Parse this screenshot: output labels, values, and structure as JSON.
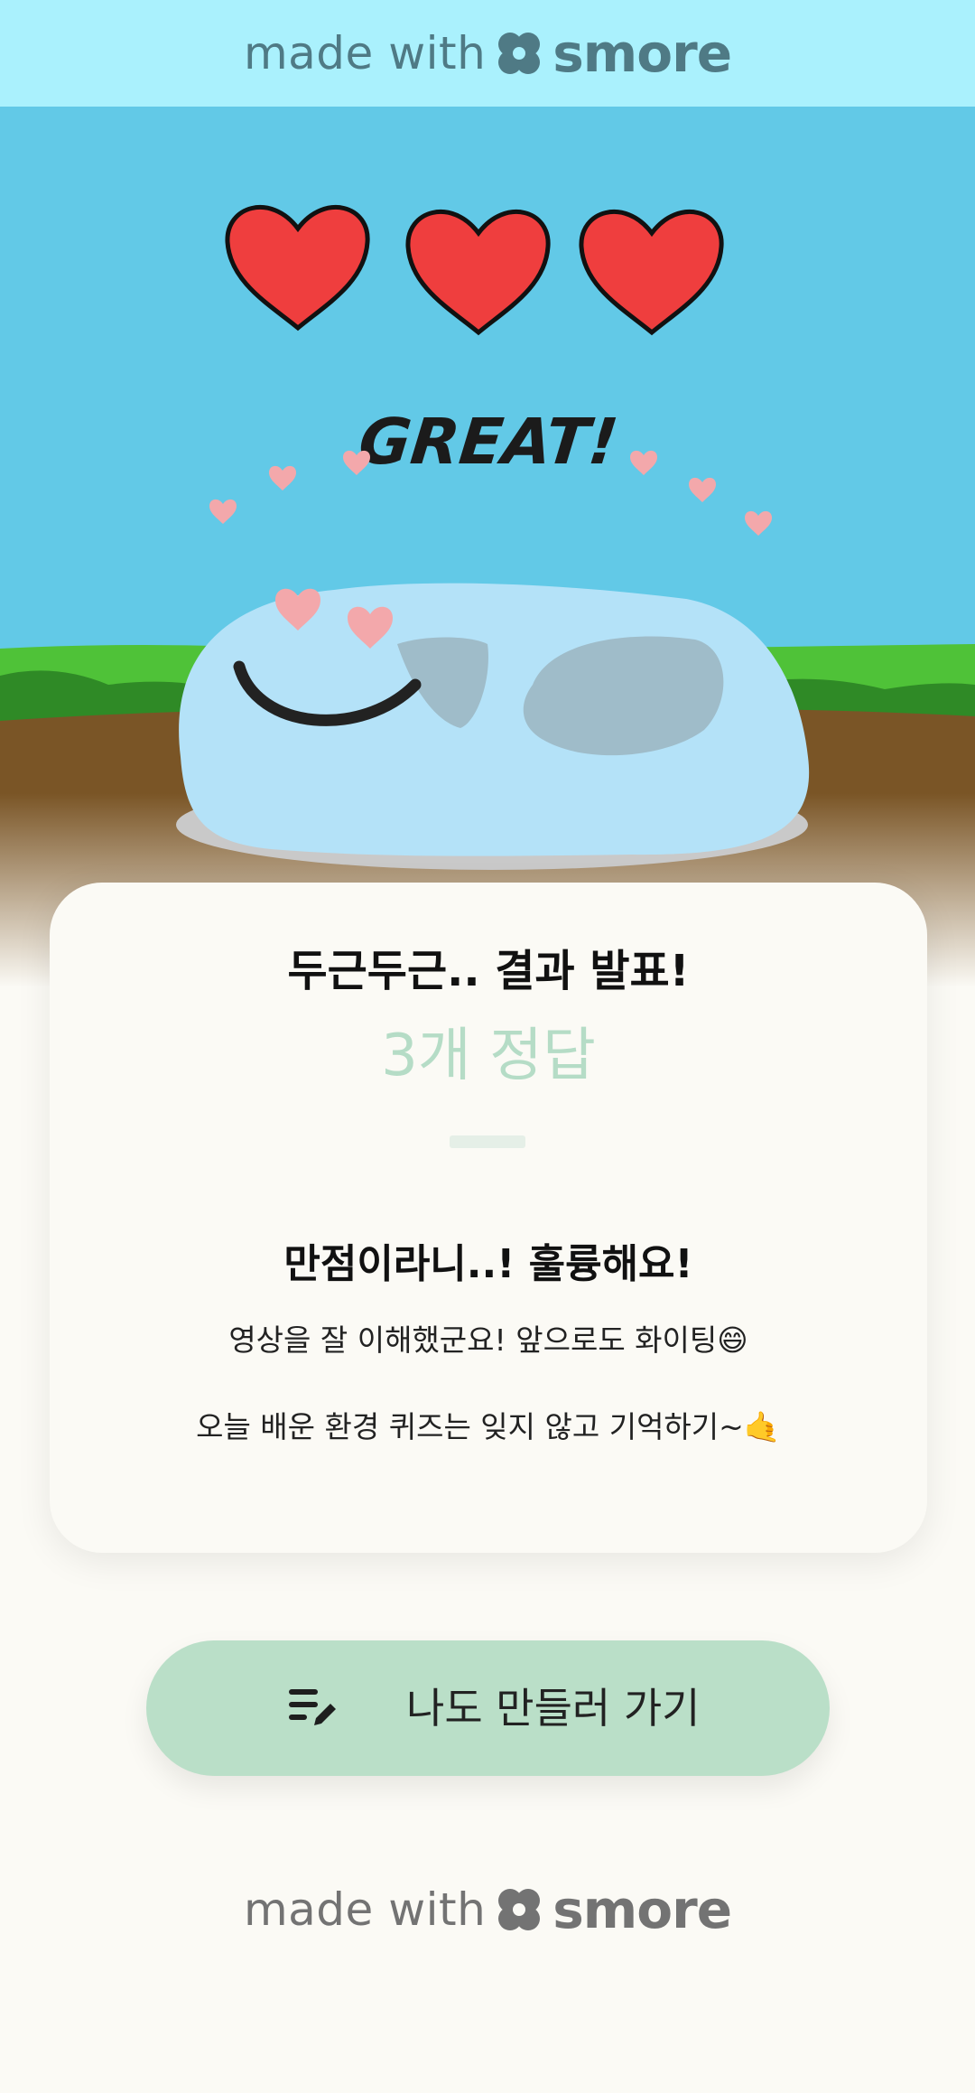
{
  "header": {
    "made_with": "made with",
    "brand": "smore"
  },
  "hero": {
    "banner_text": "GREAT!",
    "hearts_count": 3
  },
  "result_card": {
    "heading": "두근두근.. 결과 발표!",
    "score": "3개 정답",
    "subtitle": "만점이라니..! 훌륭해요!",
    "line1": "영상을 잘 이해했군요! 앞으로도 화이팅😄",
    "line2": "오늘 배운 환경 퀴즈는 잊지 않고 기억하기~🤙"
  },
  "cta": {
    "label": "나도 만들러 가기",
    "icon": "edit-list-icon"
  },
  "footer": {
    "made_with": "made with",
    "brand": "smore"
  },
  "colors": {
    "header_bg": "#aaf1fd",
    "sky": "#62c9e7",
    "page_bg": "#fbfaf5",
    "score": "#b5dcc6",
    "button": "#badfc8",
    "heart": "#ef3e3e"
  }
}
